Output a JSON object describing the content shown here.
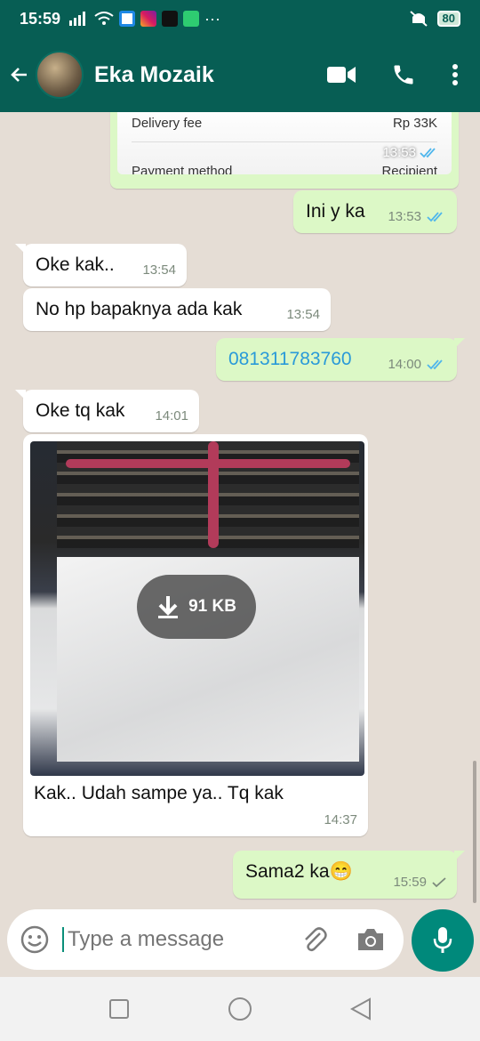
{
  "status_bar": {
    "time": "15:59",
    "battery": "80",
    "ellipsis": "···"
  },
  "header": {
    "contact_name": "Eka Mozaik"
  },
  "receipt_preview": {
    "row1_label": "Delivery fee",
    "row1_value": "Rp 33K",
    "row2_label": "Payment method",
    "row2_value": "Recipient",
    "time": "13:53"
  },
  "messages": [
    {
      "text": "Ini y ka",
      "time": "13:53"
    },
    {
      "text": "Oke kak..",
      "time": "13:54"
    },
    {
      "text": "No hp bapaknya ada kak",
      "time": "13:54"
    },
    {
      "text": "081311783760",
      "time": "14:00"
    },
    {
      "text": "Oke tq kak",
      "time": "14:01"
    },
    {
      "text": "Kak.. Udah sampe ya.. Tq kak",
      "time": "14:37",
      "download_size": "91 KB"
    },
    {
      "text": "Sama2 ka😁",
      "time": "15:59"
    }
  ],
  "composer": {
    "placeholder": "Type a message"
  },
  "colors": {
    "header": "#075e54",
    "outgoing": "#dcf8c6",
    "incoming": "#ffffff",
    "read_ticks": "#4fb6ec",
    "delivered_ticks": "#7c8a7c",
    "fab": "#00897b"
  },
  "icons": [
    "back-arrow-icon",
    "video-call-icon",
    "phone-icon",
    "more-vert-icon",
    "emoji-icon",
    "attach-icon",
    "camera-icon",
    "mic-icon",
    "download-icon",
    "nav-square-icon",
    "nav-circle-icon",
    "nav-back-icon"
  ]
}
